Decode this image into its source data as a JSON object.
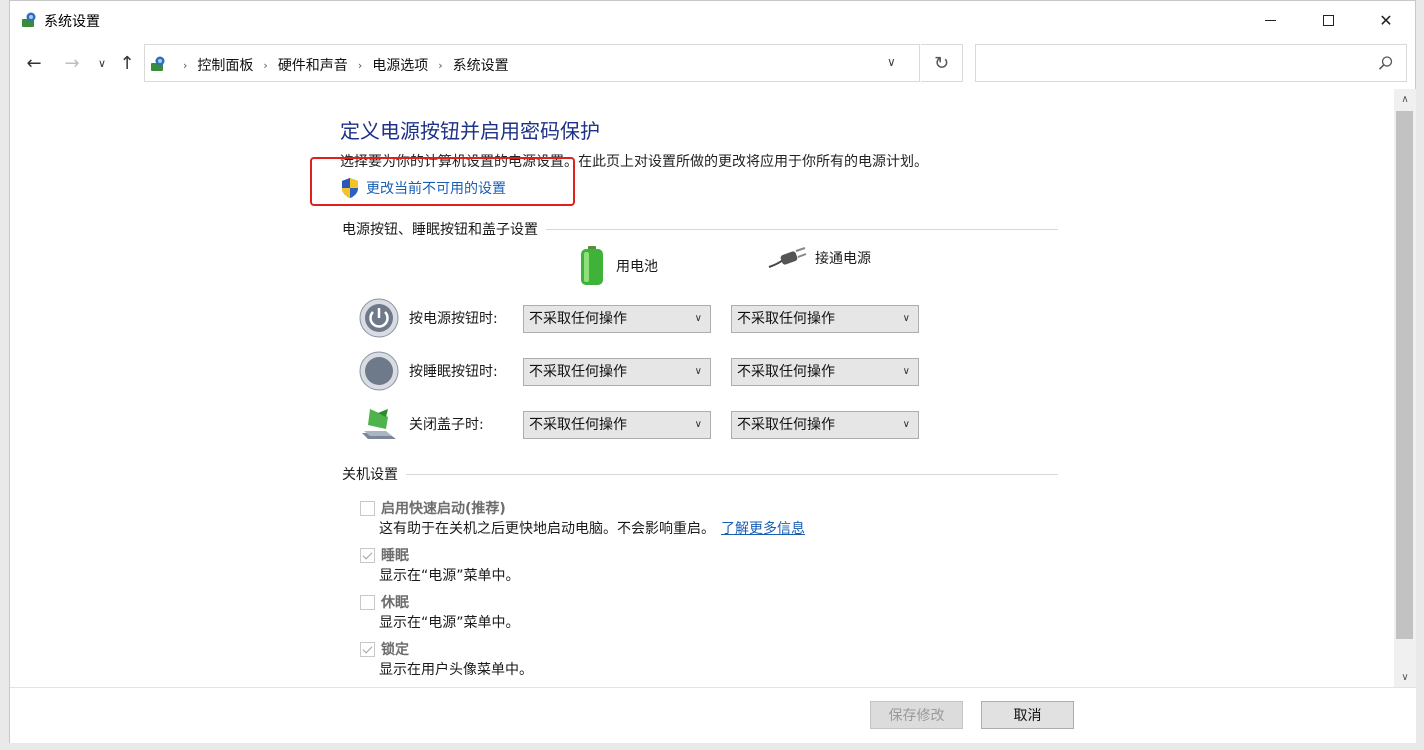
{
  "window": {
    "title": "系统设置"
  },
  "nav": {
    "breadcrumbs": [
      "控制面板",
      "硬件和声音",
      "电源选项",
      "系统设置"
    ],
    "search_placeholder": ""
  },
  "page": {
    "heading": "定义电源按钮并启用密码保护",
    "description": "选择要为你的计算机设置的电源设置。在此页上对设置所做的更改将应用于你所有的电源计划。",
    "change_link": "更改当前不可用的设置"
  },
  "buttons_section": {
    "title": "电源按钮、睡眠按钮和盖子设置",
    "col_battery": "用电池",
    "col_plugged": "接通电源",
    "rows": [
      {
        "label": "按电源按钮时:",
        "battery": "不采取任何操作",
        "plugged": "不采取任何操作",
        "icon": "power-icon"
      },
      {
        "label": "按睡眠按钮时:",
        "battery": "不采取任何操作",
        "plugged": "不采取任何操作",
        "icon": "sleep-icon"
      },
      {
        "label": "关闭盖子时:",
        "battery": "不采取任何操作",
        "plugged": "不采取任何操作",
        "icon": "lid-icon"
      }
    ]
  },
  "shutdown_section": {
    "title": "关机设置",
    "items": [
      {
        "label": "启用快速启动(推荐)",
        "checked": false,
        "desc": "这有助于在关机之后更快地启动电脑。不会影响重启。",
        "link": "了解更多信息"
      },
      {
        "label": "睡眠",
        "checked": true,
        "desc": "显示在“电源”菜单中。"
      },
      {
        "label": "休眠",
        "checked": false,
        "desc": "显示在“电源”菜单中。"
      },
      {
        "label": "锁定",
        "checked": true,
        "desc": "显示在用户头像菜单中。"
      }
    ]
  },
  "footer": {
    "save": "保存修改",
    "cancel": "取消"
  },
  "colors": {
    "heading": "#1e3287",
    "link": "#1a5fb4",
    "highlight_box": "#e0201b"
  }
}
